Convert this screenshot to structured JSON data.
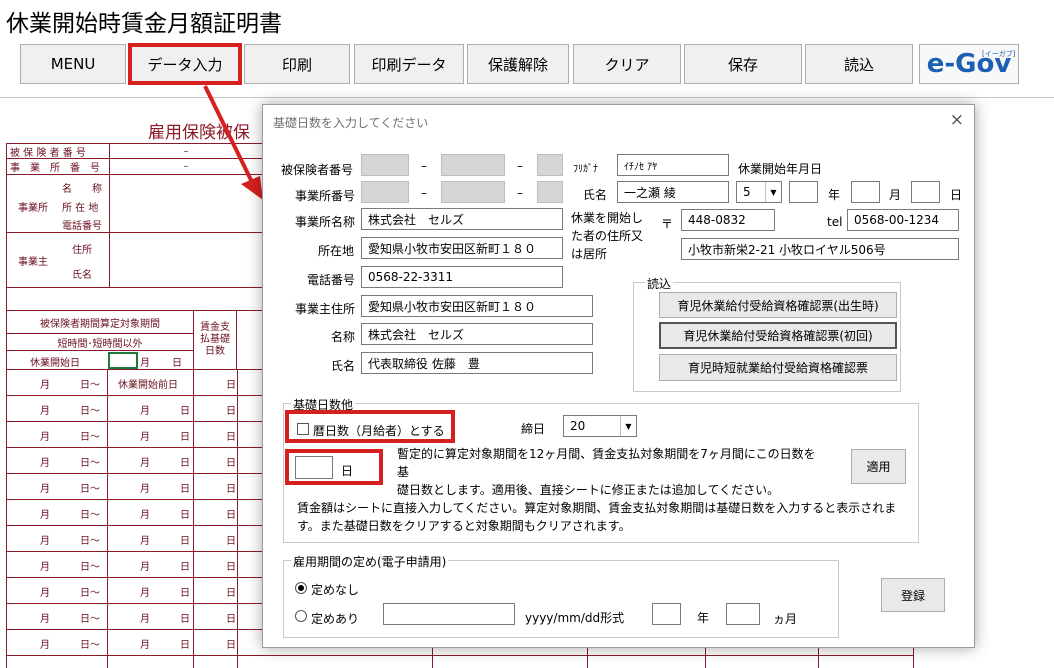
{
  "sheet": {
    "title": "休業開始時賃金月額証明書",
    "toolbar": [
      "MENU",
      "データ入力",
      "印刷",
      "印刷データ",
      "保護解除",
      "クリア",
      "保存",
      "読込"
    ],
    "egov_logo": "e-Gov",
    "egov_sub": "[イーガブ]",
    "heading": "雇用保険被保",
    "rows": {
      "insured_no": "被 保 険 者 番 号",
      "office_no": "事　業　所　番　号",
      "dash": "–",
      "name_label": "名　　称",
      "office_label": "事業所",
      "address_label": "所 在 地",
      "phone_label": "電話番号",
      "owner_label": "事業主",
      "owner_addr": "住所",
      "owner_name": "氏名",
      "period_header": "被保険者期間算定対象期間",
      "short_time": "短時間･短時間以外",
      "leave_start": "休業開始日",
      "month": "月",
      "day": "日",
      "wage_header": "賃金支払基礎日数",
      "row_from": "月　　　日～",
      "leave_prev": "休業開始前日",
      "row_to": "月　　　日"
    }
  },
  "dialog": {
    "title": "基礎日数を入力してください",
    "close": "×",
    "labels": {
      "insured_no": "被保険者番号",
      "office_no": "事業所番号",
      "office_name": "事業所名称",
      "address": "所在地",
      "phone": "電話番号",
      "owner_address": "事業主住所",
      "owner_name": "名称",
      "owner_person": "氏名",
      "furigana": "ﾌﾘｶﾞﾅ",
      "name": "氏名",
      "leave_start": "休業開始年月日",
      "era_year": "年",
      "month": "月",
      "day": "日",
      "reside_line1": "休業を開始し",
      "reside_line2": "た者の住所又",
      "reside_line3": "は居所",
      "postal_mark": "〒",
      "tel": "tel",
      "dash": "–"
    },
    "values": {
      "furigana": "ｲﾁﾉｾ ｱﾔ",
      "name": "一之瀬 綾",
      "era_select": "5",
      "office_name": "株式会社　セルズ",
      "address": "愛知県小牧市安田区新町１８０",
      "phone": "0568-22-3311",
      "owner_address": "愛知県小牧市安田区新町１８０",
      "owner_name": "株式会社　セルズ",
      "owner_person": "代表取締役 佐藤　豊",
      "postal": "448-0832",
      "tel": "0568-00-1234",
      "person_address": "小牧市新栄2-21 小牧ロイヤル506号"
    },
    "read": {
      "legend": "読込",
      "buttons": [
        "育児休業給付受給資格確認票(出生時)",
        "育児休業給付受給資格確認票(初回)",
        "育児時短就業給付受給資格確認票"
      ]
    },
    "basic": {
      "legend": "基礎日数他",
      "calendar_check": "暦日数（月給者）とする",
      "close_day_label": "締日",
      "close_day": "20",
      "days_unit": "日",
      "note1": "暫定的に算定対象期間を12ヶ月間、賃金支払対象期間を7ヶ月間にこの日数を基",
      "note2": "礎日数とします。適用後、直接シートに修正または追加してください。",
      "apply": "適用",
      "note3": "賃金額はシートに直接入力してください。算定対象期間、賃金支払対象期間は基礎日数を入力すると表示されま",
      "note4": "す。また基礎日数をクリアすると対象期間もクリアされます。"
    },
    "employment": {
      "legend": "雇用期間の定め(電子申請用)",
      "none": "定めなし",
      "exists": "定めあり",
      "date_format": "yyyy/mm/dd形式",
      "year": "年",
      "month": "ヵ月",
      "register": "登録"
    }
  }
}
